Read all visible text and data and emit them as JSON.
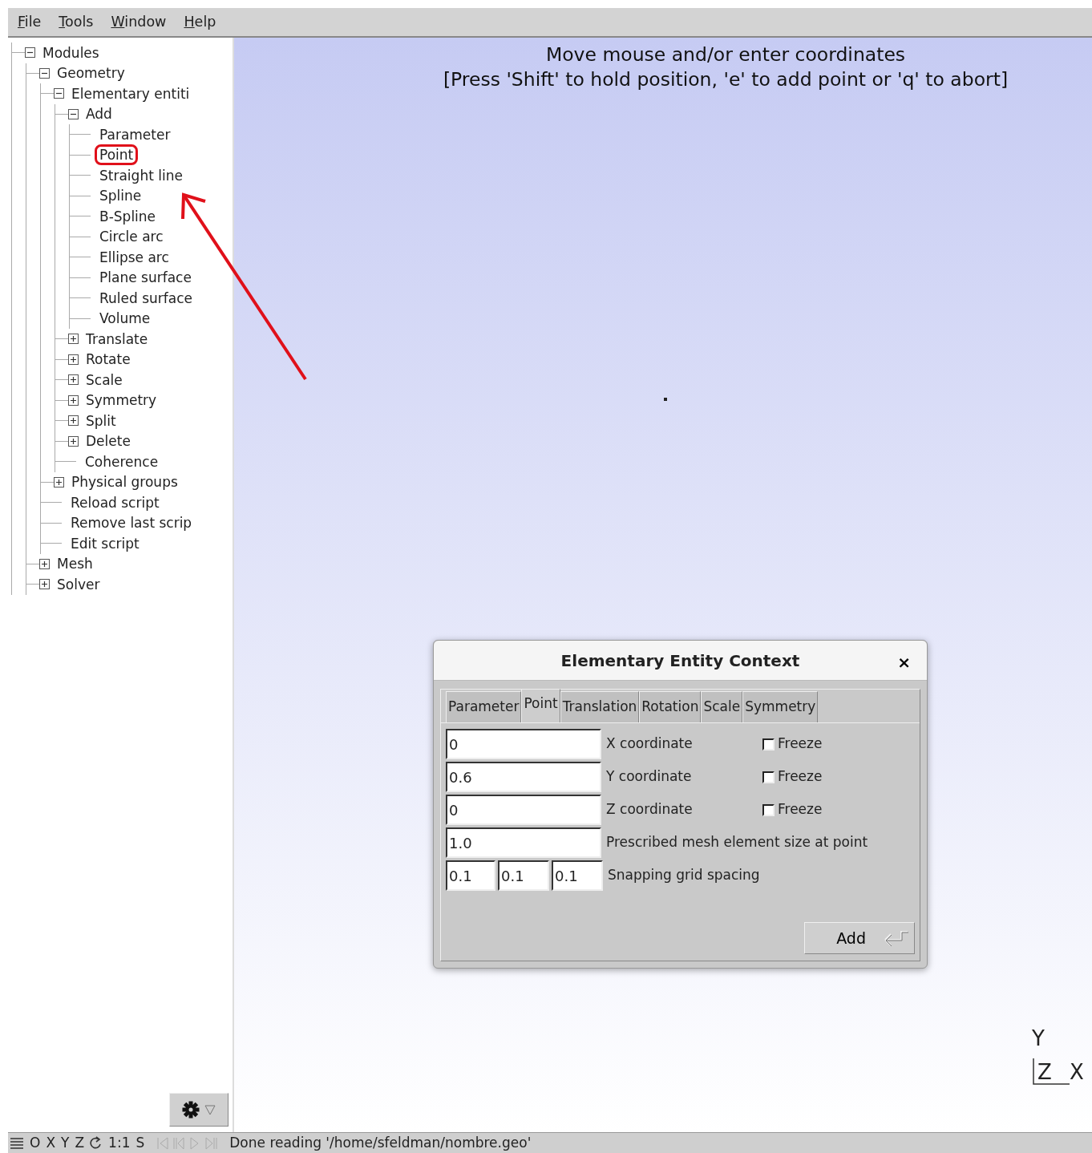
{
  "menu": [
    {
      "label": "File"
    },
    {
      "label": "Tools"
    },
    {
      "label": "Window"
    },
    {
      "label": "Help"
    }
  ],
  "tree": [
    {
      "label": "Modules",
      "expanded": true,
      "children": [
        {
          "label": "Geometry",
          "expanded": true,
          "children": [
            {
              "label": "Elementary entiti",
              "expanded": true,
              "children": [
                {
                  "label": "Add",
                  "expanded": true,
                  "children": [
                    {
                      "label": "Parameter",
                      "circled": false
                    },
                    {
                      "label": "Point",
                      "circled": true
                    },
                    {
                      "label": "Straight line",
                      "circled": false
                    },
                    {
                      "label": "Spline",
                      "circled": false
                    },
                    {
                      "label": "B-Spline",
                      "circled": false
                    },
                    {
                      "label": "Circle arc",
                      "circled": false
                    },
                    {
                      "label": "Ellipse arc",
                      "circled": false
                    },
                    {
                      "label": "Plane surface",
                      "circled": false
                    },
                    {
                      "label": "Ruled surface",
                      "circled": false
                    },
                    {
                      "label": "Volume",
                      "circled": false
                    }
                  ]
                },
                {
                  "label": "Translate",
                  "expanded": false
                },
                {
                  "label": "Rotate",
                  "expanded": false
                },
                {
                  "label": "Scale",
                  "expanded": false
                },
                {
                  "label": "Symmetry",
                  "expanded": false
                },
                {
                  "label": "Split",
                  "expanded": false
                },
                {
                  "label": "Delete",
                  "expanded": false
                },
                {
                  "label": "Coherence"
                }
              ]
            },
            {
              "label": "Physical groups",
              "expanded": false
            },
            {
              "label": "Reload script"
            },
            {
              "label": "Remove last scrip"
            },
            {
              "label": "Edit script"
            }
          ]
        },
        {
          "label": "Mesh",
          "expanded": false
        },
        {
          "label": "Solver",
          "expanded": false
        }
      ]
    }
  ],
  "prompt": [
    "Move mouse and/or enter coordinates",
    "[Press 'Shift' to hold position, 'e' to add point or 'q' to abort]"
  ],
  "axes": {
    "y": "Y",
    "z": "Z",
    "x": "X"
  },
  "dialog": {
    "title": "Elementary Entity Context",
    "close": "×",
    "tabs": [
      {
        "label": "Parameter",
        "selected": false
      },
      {
        "label": "Point",
        "selected": true
      },
      {
        "label": "Translation",
        "selected": false
      },
      {
        "label": "Rotation",
        "selected": false
      },
      {
        "label": "Scale",
        "selected": false
      },
      {
        "label": "Symmetry",
        "selected": false
      }
    ],
    "rows": [
      {
        "kind": "freeze",
        "values": [
          "0"
        ],
        "label": "X coordinate",
        "freeze": {
          "label": "Freeze",
          "checked": false
        }
      },
      {
        "kind": "freeze",
        "values": [
          "0.6"
        ],
        "label": "Y coordinate",
        "freeze": {
          "label": "Freeze",
          "checked": false
        }
      },
      {
        "kind": "freeze",
        "values": [
          "0"
        ],
        "label": "Z coordinate",
        "freeze": {
          "label": "Freeze",
          "checked": false
        }
      },
      {
        "kind": "plain",
        "values": [
          "1.0"
        ],
        "label": "Prescribed mesh element size at point"
      },
      {
        "kind": "plain",
        "values": [
          "0.1",
          "0.1",
          "0.1"
        ],
        "label": "Snapping grid spacing"
      }
    ],
    "button": "Add"
  },
  "status_bar": {
    "items": [
      {
        "kind": "text",
        "label": "O"
      },
      {
        "kind": "text",
        "label": "X"
      },
      {
        "kind": "text",
        "label": "Y"
      },
      {
        "kind": "text",
        "label": "Z"
      },
      {
        "kind": "rotate"
      },
      {
        "kind": "text",
        "label": "1:1"
      },
      {
        "kind": "text",
        "label": "S"
      }
    ],
    "playback_enabled": false,
    "message": "Done reading '/home/sfeldman/nombre.geo'"
  }
}
